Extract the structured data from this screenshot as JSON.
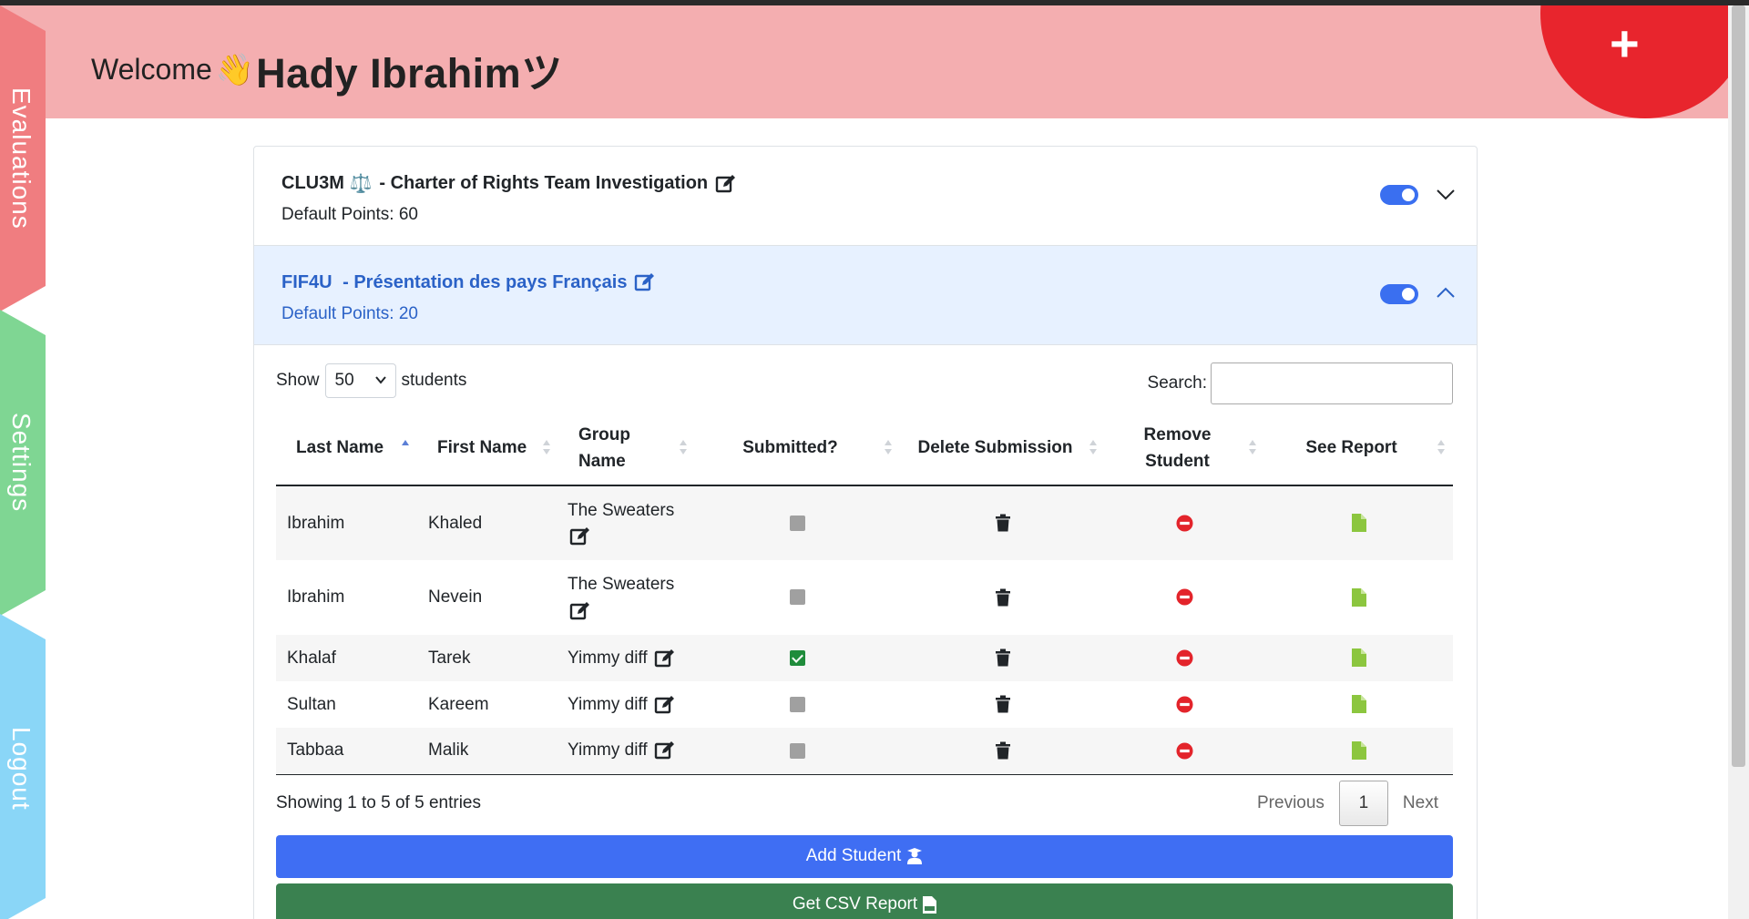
{
  "header": {
    "welcome_label": "Welcome",
    "wave_emoji": "👋",
    "user_name": "Hady Ibrahimツ",
    "add_symbol": "+"
  },
  "sidebar": {
    "tabs": [
      {
        "label": "Evaluations",
        "color": "#f07d80"
      },
      {
        "label": "Settings",
        "color": "#7fd693"
      },
      {
        "label": "Logout",
        "color": "#8ad6f7"
      }
    ]
  },
  "evaluations": [
    {
      "course": "CLU3M",
      "emoji": "⚖️",
      "title": " - Charter of Rights Team Investigation",
      "points_label": "Default Points: 60",
      "enabled": true,
      "expanded": false
    },
    {
      "course": "FIF4U",
      "emoji": "",
      "title": " - Présentation des pays Français",
      "points_label": "Default Points: 20",
      "enabled": true,
      "expanded": true
    }
  ],
  "table_controls": {
    "show_label": "Show",
    "page_size": "50",
    "students_label": "students",
    "search_label": "Search:",
    "search_value": ""
  },
  "columns": {
    "last_name": "Last Name",
    "first_name": "First Name",
    "group_name_1": "Group",
    "group_name_2": "Name",
    "submitted": "Submitted?",
    "delete_submission": "Delete Submission",
    "remove_student_1": "Remove",
    "remove_student_2": "Student",
    "see_report": "See Report"
  },
  "students": [
    {
      "last": "Ibrahim",
      "first": "Khaled",
      "group": "The Sweaters",
      "submitted": false
    },
    {
      "last": "Ibrahim",
      "first": "Nevein",
      "group": "The Sweaters",
      "submitted": false
    },
    {
      "last": "Khalaf",
      "first": "Tarek",
      "group": "Yimmy diff",
      "submitted": true
    },
    {
      "last": "Sultan",
      "first": "Kareem",
      "group": "Yimmy diff",
      "submitted": false
    },
    {
      "last": "Tabbaa",
      "first": "Malik",
      "group": "Yimmy diff",
      "submitted": false
    }
  ],
  "pagination": {
    "info": "Showing 1 to 5 of 5 entries",
    "previous": "Previous",
    "current_page": "1",
    "next": "Next"
  },
  "actions": {
    "add_student": "Add Student",
    "csv_report": "Get CSV Report"
  },
  "colors": {
    "header_bg": "#f4aeb0",
    "fab": "#e8252d",
    "accent_blue": "#3f6ef3",
    "accent_green": "#3a8150",
    "delete_red": "#e3242b",
    "report_green": "#8cc63f"
  }
}
